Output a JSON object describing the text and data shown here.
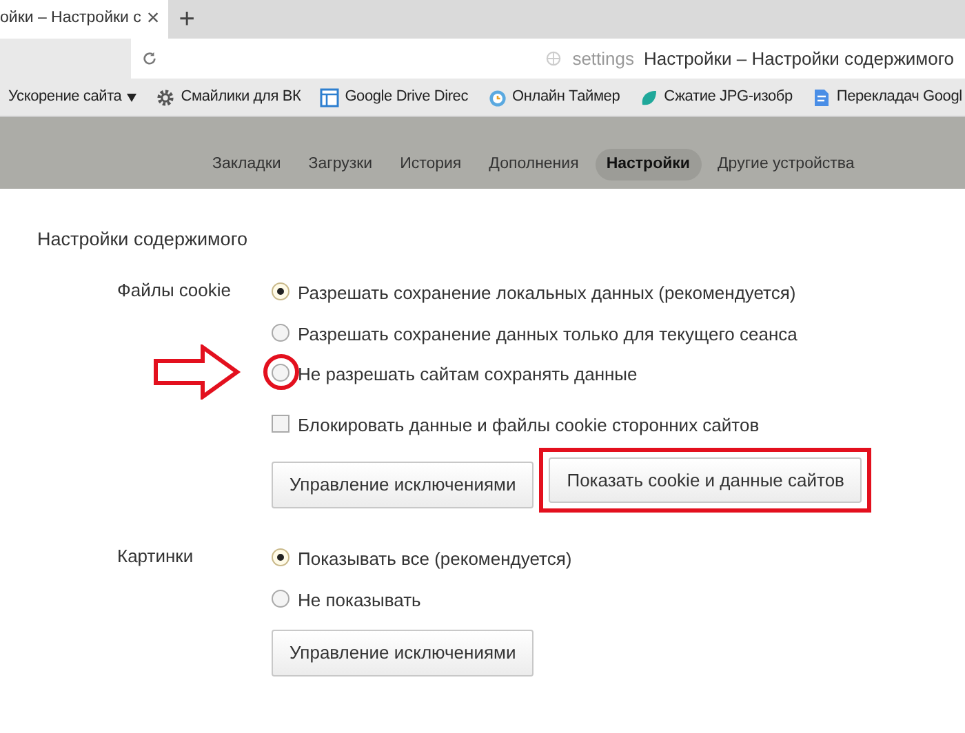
{
  "browser_tab": {
    "title": "ойки – Настройки с",
    "close": "×",
    "new_tab": "+"
  },
  "address_bar": {
    "scheme": "settings",
    "page_title": "Настройки – Настройки содержимого"
  },
  "bookmarks": [
    {
      "label": "Ускорение сайта",
      "kind": "folder"
    },
    {
      "label": "Смайлики для ВК",
      "kind": "gear"
    },
    {
      "label": "Google Drive Direc",
      "kind": "window"
    },
    {
      "label": "Онлайн Таймер",
      "kind": "clock"
    },
    {
      "label": "Сжатие JPG-изобр",
      "kind": "leaf"
    },
    {
      "label": "Перекладач Googl",
      "kind": "document"
    }
  ],
  "nav_tabs": [
    {
      "label": "Закладки",
      "selected": false
    },
    {
      "label": "Загрузки",
      "selected": false
    },
    {
      "label": "История",
      "selected": false
    },
    {
      "label": "Дополнения",
      "selected": false
    },
    {
      "label": "Настройки",
      "selected": true
    },
    {
      "label": "Другие устройства",
      "selected": false
    }
  ],
  "heading": "Настройки содержимого",
  "sections": [
    {
      "label": "Файлы cookie",
      "options": [
        {
          "kind": "radio",
          "label": "Разрешать сохранение локальных данных (рекомендуется)",
          "selected": true,
          "highlighted": false
        },
        {
          "kind": "radio",
          "label": "Разрешать сохранение данных только для текущего сеанса",
          "selected": false,
          "highlighted": false
        },
        {
          "kind": "radio",
          "label": "Не разрешать сайтам сохранять данные",
          "selected": false,
          "highlighted": true
        },
        {
          "kind": "checkbox",
          "label": "Блокировать данные и файлы cookie сторонних сайтов",
          "checked": false
        }
      ],
      "buttons": [
        {
          "label": "Управление исключениями",
          "highlighted": false
        },
        {
          "label": "Показать cookie и данные сайтов",
          "highlighted": true
        }
      ]
    },
    {
      "label": "Картинки",
      "options": [
        {
          "kind": "radio",
          "label": "Показывать все (рекомендуется)",
          "selected": true,
          "highlighted": false
        },
        {
          "kind": "radio",
          "label": "Не показывать",
          "selected": false,
          "highlighted": false
        }
      ],
      "buttons": [
        {
          "label": "Управление исключениями",
          "highlighted": false
        }
      ]
    }
  ]
}
